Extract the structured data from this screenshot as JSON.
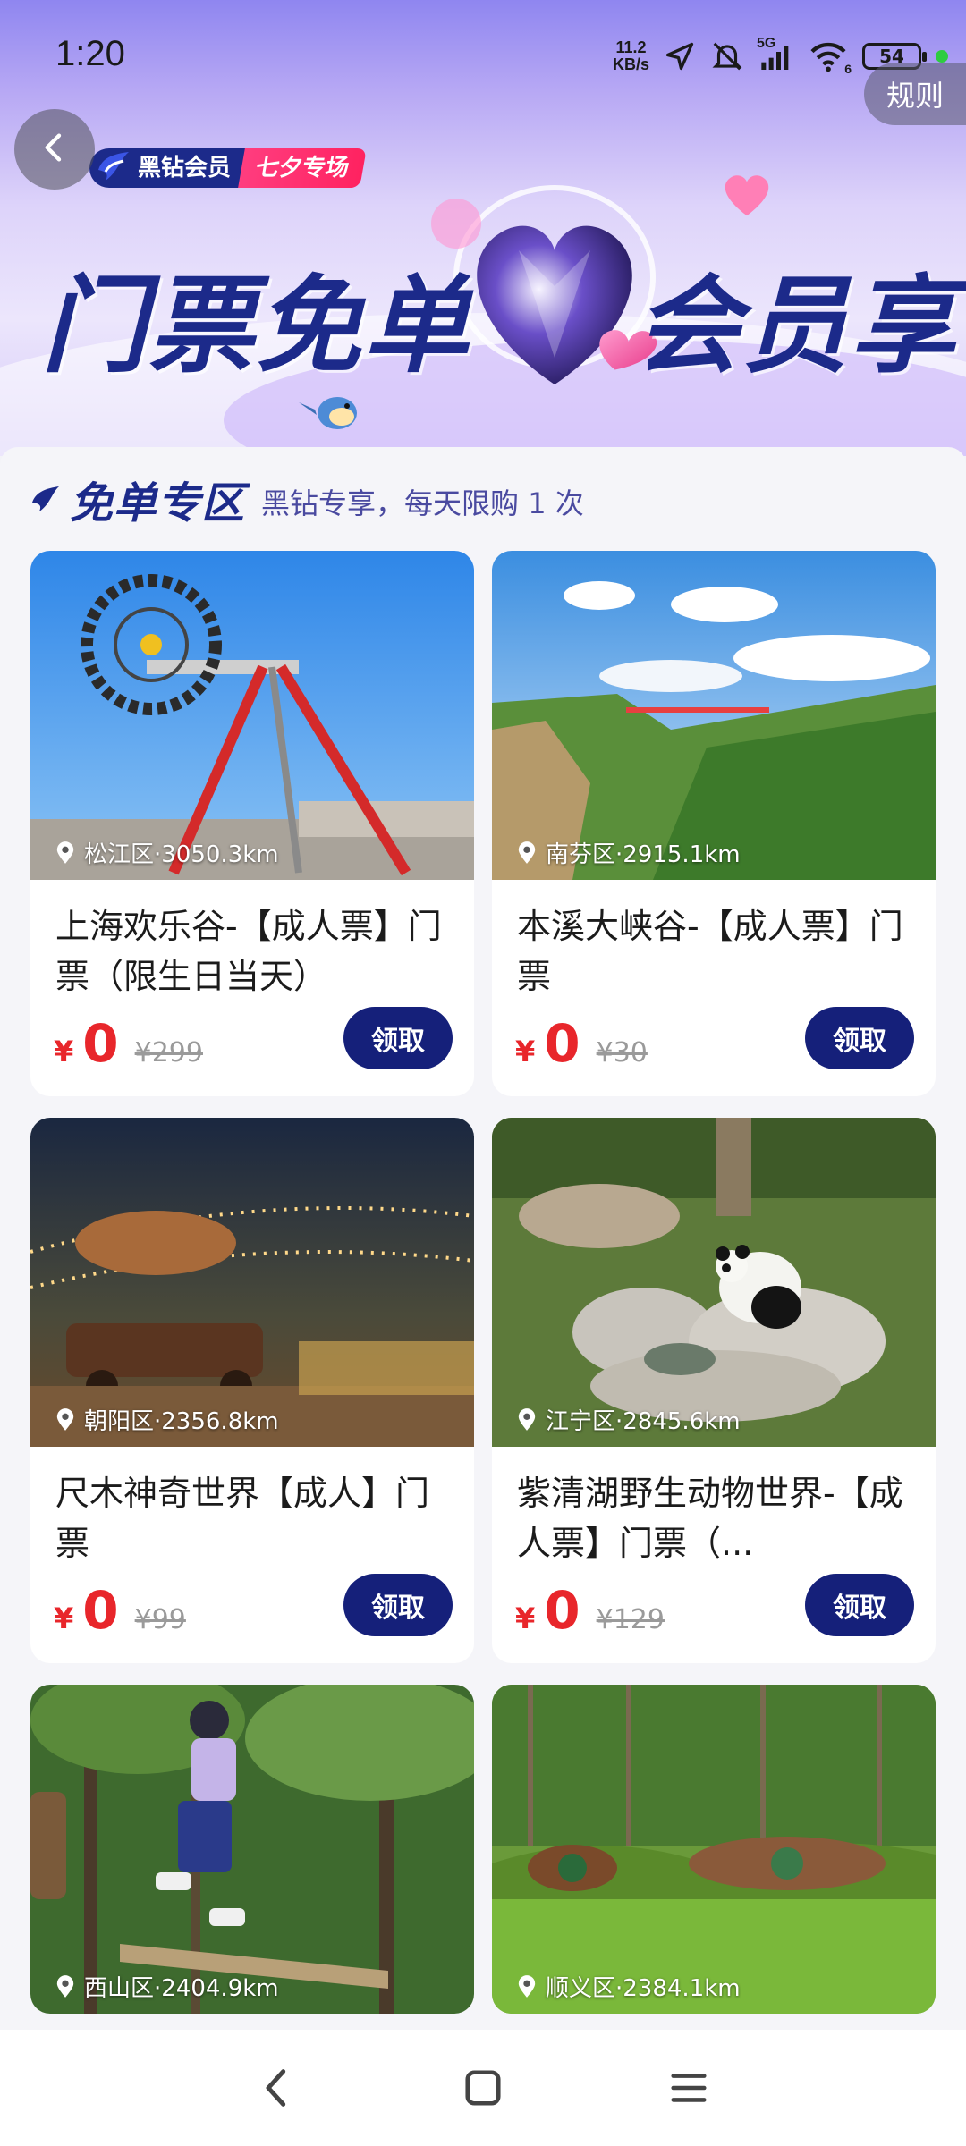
{
  "status_bar": {
    "time": "1:20",
    "net_speed_value": "11.2",
    "net_speed_unit": "KB/s",
    "signal_label": "5G",
    "wifi_label": "6",
    "battery": "54"
  },
  "header": {
    "rules_label": "规则",
    "brand_vip": "黑钻会员",
    "brand_event": "七夕专场",
    "headline_left": "门票免单",
    "headline_right": "会员享"
  },
  "section": {
    "title": "免单专区",
    "subtitle": "黑钻专享，每天限购 1 次"
  },
  "cards": [
    {
      "location": "松江区·3050.3km",
      "title": "上海欢乐谷-【成人票】门票（限生日当天）",
      "currency": "¥",
      "price": "0",
      "original_price": "¥299",
      "button": "领取"
    },
    {
      "location": "南芬区·2915.1km",
      "title": "本溪大峡谷-【成人票】门票",
      "currency": "¥",
      "price": "0",
      "original_price": "¥30",
      "button": "领取"
    },
    {
      "location": "朝阳区·2356.8km",
      "title": "尺木神奇世界【成人】门票",
      "currency": "¥",
      "price": "0",
      "original_price": "¥99",
      "button": "领取"
    },
    {
      "location": "江宁区·2845.6km",
      "title": "紫清湖野生动物世界-【成人票】门票（...",
      "currency": "¥",
      "price": "0",
      "original_price": "¥129",
      "button": "领取"
    },
    {
      "location": "西山区·2404.9km"
    },
    {
      "location": "顺义区·2384.1km"
    }
  ],
  "colors": {
    "brand_navy": "#1c2a8a",
    "button_navy": "#15207a",
    "price_red": "#e8262b",
    "event_pink": "#ff2260"
  },
  "icons": {
    "back": "chevron-left-icon",
    "location": "location-pin-icon",
    "nav_back": "nav-back-icon",
    "nav_home": "nav-home-icon",
    "nav_menu": "nav-menu-icon"
  }
}
